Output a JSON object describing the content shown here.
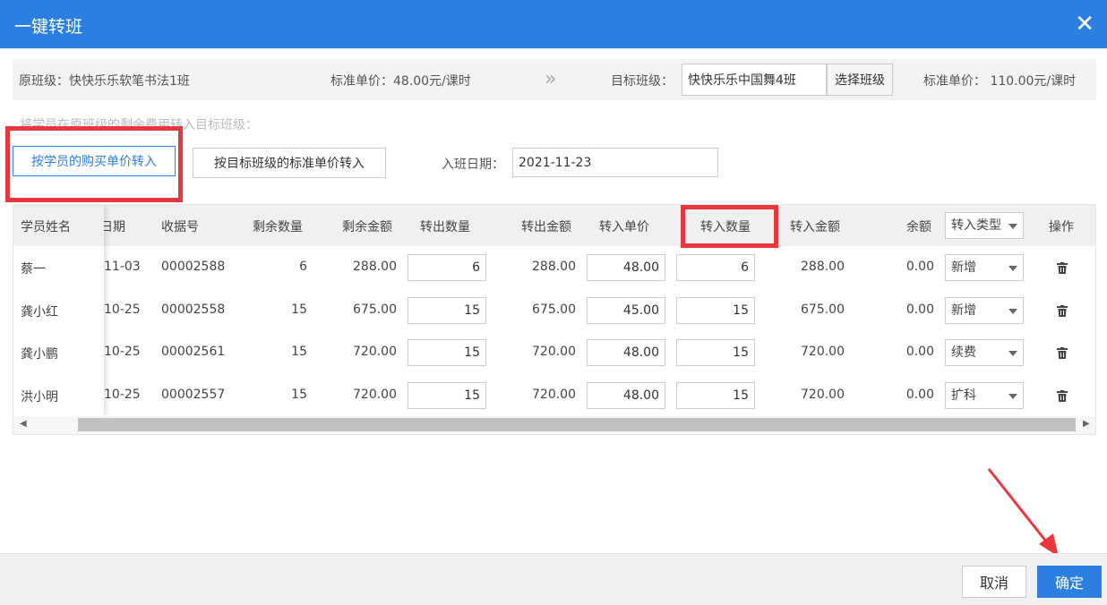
{
  "dialog": {
    "title": "一键转班",
    "close_glyph": "✕"
  },
  "info": {
    "original_class": "原班级：快快乐乐软笔书法1班",
    "original_price": "标准单价：48.00元/课时",
    "arrows": "»",
    "target_label": "目标班级：",
    "target_value": "快快乐乐中国舞4班",
    "select_button": "选择班级",
    "target_price": "标准单价： 110.00元/课时"
  },
  "hint": "将学员在原班级的剩余费用转入目标班级：",
  "mode": {
    "by_purchase": "按学员的购买单价转入",
    "by_standard": "按目标班级的标准单价转入"
  },
  "enroll": {
    "label": "入班日期：",
    "date": "2021-11-23"
  },
  "table": {
    "headers": {
      "name": "学员姓名",
      "date": "日期",
      "receipt": "收据号",
      "remain_qty": "剩余数量",
      "remain_amt": "剩余金额",
      "out_qty": "转出数量",
      "out_amt": "转出金额",
      "in_price": "转入单价",
      "in_qty": "转入数量",
      "in_amt": "转入金额",
      "balance": "余额",
      "in_type": "转入类型",
      "action": "操作"
    },
    "rows": [
      {
        "name": "蔡一",
        "date": "11-03",
        "receipt": "00002588",
        "remain_qty": "6",
        "remain_amt": "288.00",
        "out_qty": "6",
        "out_amt": "288.00",
        "in_price": "48.00",
        "in_qty": "6",
        "in_amt": "288.00",
        "balance": "0.00",
        "in_type": "新增"
      },
      {
        "name": "龚小红",
        "date": "10-25",
        "receipt": "00002558",
        "remain_qty": "15",
        "remain_amt": "675.00",
        "out_qty": "15",
        "out_amt": "675.00",
        "in_price": "45.00",
        "in_qty": "15",
        "in_amt": "675.00",
        "balance": "0.00",
        "in_type": "新增"
      },
      {
        "name": "龚小鹏",
        "date": "10-25",
        "receipt": "00002561",
        "remain_qty": "15",
        "remain_amt": "720.00",
        "out_qty": "15",
        "out_amt": "720.00",
        "in_price": "48.00",
        "in_qty": "15",
        "in_amt": "720.00",
        "balance": "0.00",
        "in_type": "续费"
      },
      {
        "name": "洪小明",
        "date": "10-25",
        "receipt": "00002557",
        "remain_qty": "15",
        "remain_amt": "720.00",
        "out_qty": "15",
        "out_amt": "720.00",
        "in_price": "48.00",
        "in_qty": "15",
        "in_amt": "720.00",
        "balance": "0.00",
        "in_type": "扩科"
      }
    ]
  },
  "scroll": {
    "left": "◀",
    "right": "▶"
  },
  "footer": {
    "cancel": "取消",
    "confirm": "确定"
  },
  "colors": {
    "primary": "#2b7fe0",
    "annotation_red": "#e8383d"
  }
}
